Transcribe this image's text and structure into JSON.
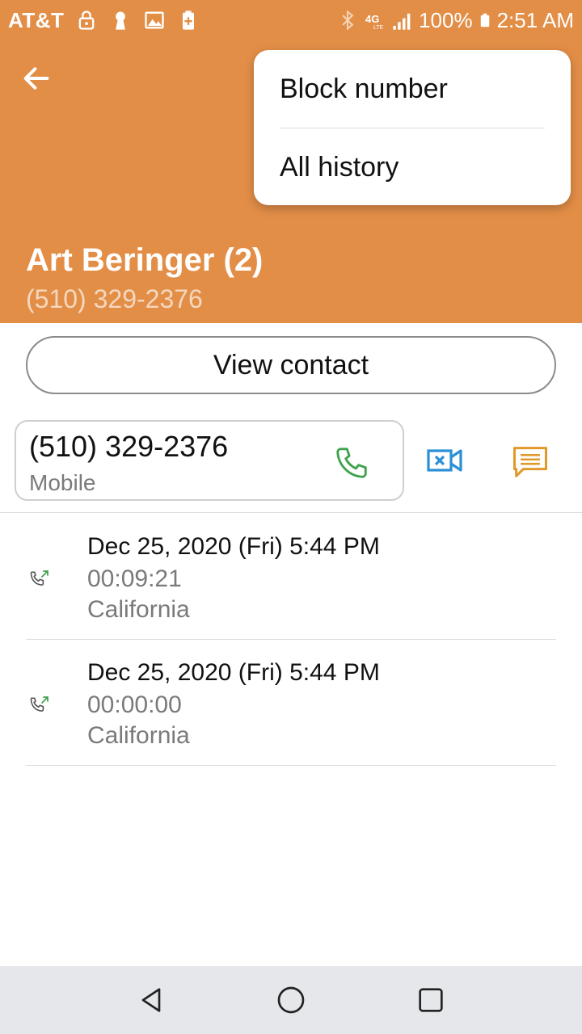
{
  "status_bar": {
    "carrier": "AT&T",
    "battery": "100%",
    "time": "2:51 AM"
  },
  "contact": {
    "name": "Art Beringer (2)",
    "number": "(510) 329-2376"
  },
  "menu": {
    "items": [
      {
        "label": "Block number"
      },
      {
        "label": "All history"
      }
    ]
  },
  "view_contact_label": "View contact",
  "phone_card": {
    "number": "(510) 329-2376",
    "type": "Mobile"
  },
  "history": [
    {
      "date": "Dec 25, 2020 (Fri) 5:44 PM",
      "duration": "00:09:21",
      "location": "California"
    },
    {
      "date": "Dec 25, 2020 (Fri) 5:44 PM",
      "duration": "00:00:00",
      "location": "California"
    }
  ],
  "colors": {
    "header": "#e38e47",
    "call_green": "#3fa34d",
    "video_blue": "#2a8fd6",
    "message_orange": "#e09a2a"
  }
}
